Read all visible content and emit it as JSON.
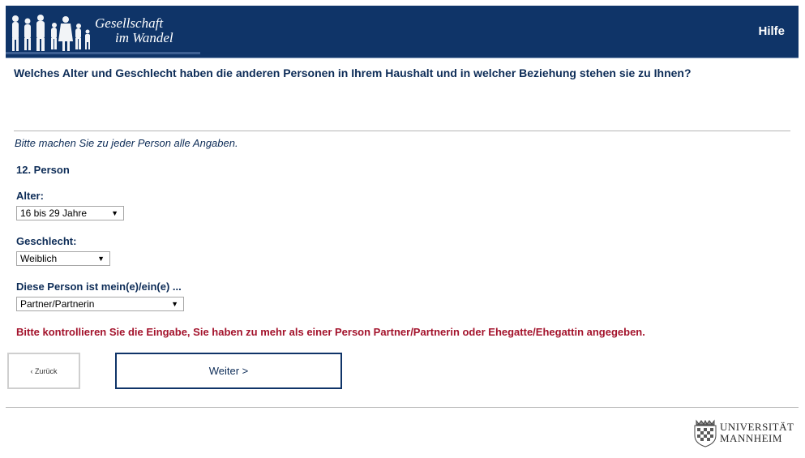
{
  "header": {
    "logo_line1": "Gesellschaft",
    "logo_line2": "im Wandel",
    "help_label": "Hilfe"
  },
  "question": "Welches Alter und Geschlecht haben die anderen Personen in Ihrem Haushalt und in welcher Beziehung stehen sie zu Ihnen?",
  "instruction": "Bitte machen Sie zu jeder Person alle Angaben.",
  "person": {
    "title": "12. Person",
    "age_label": "Alter:",
    "age_value": "16 bis 29 Jahre",
    "gender_label": "Geschlecht:",
    "gender_value": "Weiblich",
    "relation_label": "Diese Person ist mein(e)/ein(e) ...",
    "relation_value": "Partner/Partnerin"
  },
  "error_message": "Bitte kontrollieren Sie die Eingabe, Sie haben zu mehr als einer Person Partner/Partnerin oder Ehegatte/Ehegattin angegeben.",
  "nav": {
    "back_label": "‹ Zurück",
    "next_label": "Weiter >"
  },
  "footer": {
    "uni_line1": "UNIVERSITÄT",
    "uni_line2": "MANNHEIM"
  },
  "colors": {
    "header_bg": "#0f3468",
    "text": "#0d2c57",
    "error": "#a3122b"
  }
}
